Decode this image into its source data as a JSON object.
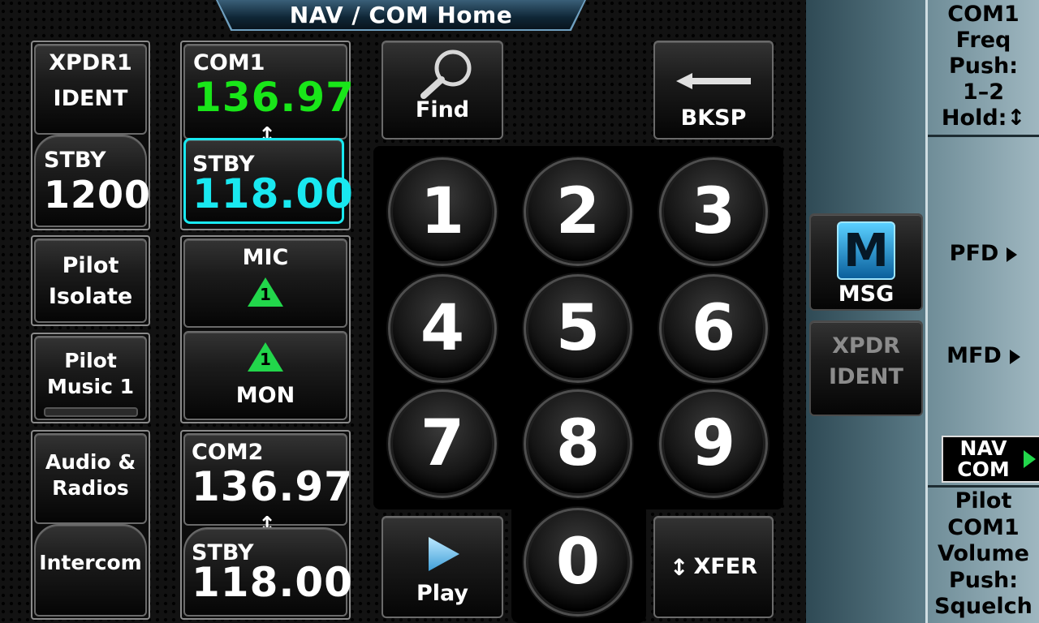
{
  "title": "NAV / COM Home",
  "xpdr": {
    "top_line1": "XPDR1",
    "top_line2": "IDENT",
    "stby_label": "STBY",
    "code": "1200"
  },
  "pilot_isolate": {
    "line1": "Pilot",
    "line2": "Isolate"
  },
  "pilot_music": {
    "line1": "Pilot",
    "line2": "Music 1"
  },
  "audio_radios": {
    "line1": "Audio &",
    "line2": "Radios"
  },
  "intercom": {
    "label": "Intercom"
  },
  "com1": {
    "label": "COM1",
    "active": "136.97",
    "stby_label": "STBY",
    "standby": "118.00",
    "swap_icon": "swap-arrows"
  },
  "mic": {
    "label": "MIC",
    "badge": "1"
  },
  "mon": {
    "label": "MON",
    "badge": "1"
  },
  "com2": {
    "label": "COM2",
    "active": "136.97",
    "stby_label": "STBY",
    "standby": "118.00"
  },
  "find": {
    "label": "Find",
    "icon": "magnifier"
  },
  "bksp": {
    "label": "BKSP",
    "icon": "left-arrow"
  },
  "keypad": {
    "k1": "1",
    "k2": "2",
    "k3": "3",
    "k4": "4",
    "k5": "5",
    "k6": "6",
    "k7": "7",
    "k8": "8",
    "k9": "9",
    "k0": "0"
  },
  "play": {
    "label": "Play",
    "icon": "play-triangle"
  },
  "xfer": {
    "label": "XFER",
    "icon": "updown-arrows"
  },
  "msg": {
    "label": "MSG",
    "icon_letter": "M"
  },
  "xpdr_ident_btn": {
    "line1": "XPDR",
    "line2": "IDENT"
  },
  "softkeys": {
    "com1_freq": [
      "COM1",
      "Freq",
      "Push:",
      "1–2",
      "Hold:↕"
    ],
    "pfd": "PFD",
    "mfd": "MFD",
    "navcom_line1": "NAV",
    "navcom_line2": "COM",
    "pilot_vol": [
      "Pilot",
      "COM1",
      "Volume",
      "Push:",
      "Squelch"
    ]
  },
  "colors": {
    "active_freq": "#19e619",
    "standby_freq": "#19e8f0",
    "warning": "#22d64b",
    "accent_cyan": "#19e8f0"
  }
}
